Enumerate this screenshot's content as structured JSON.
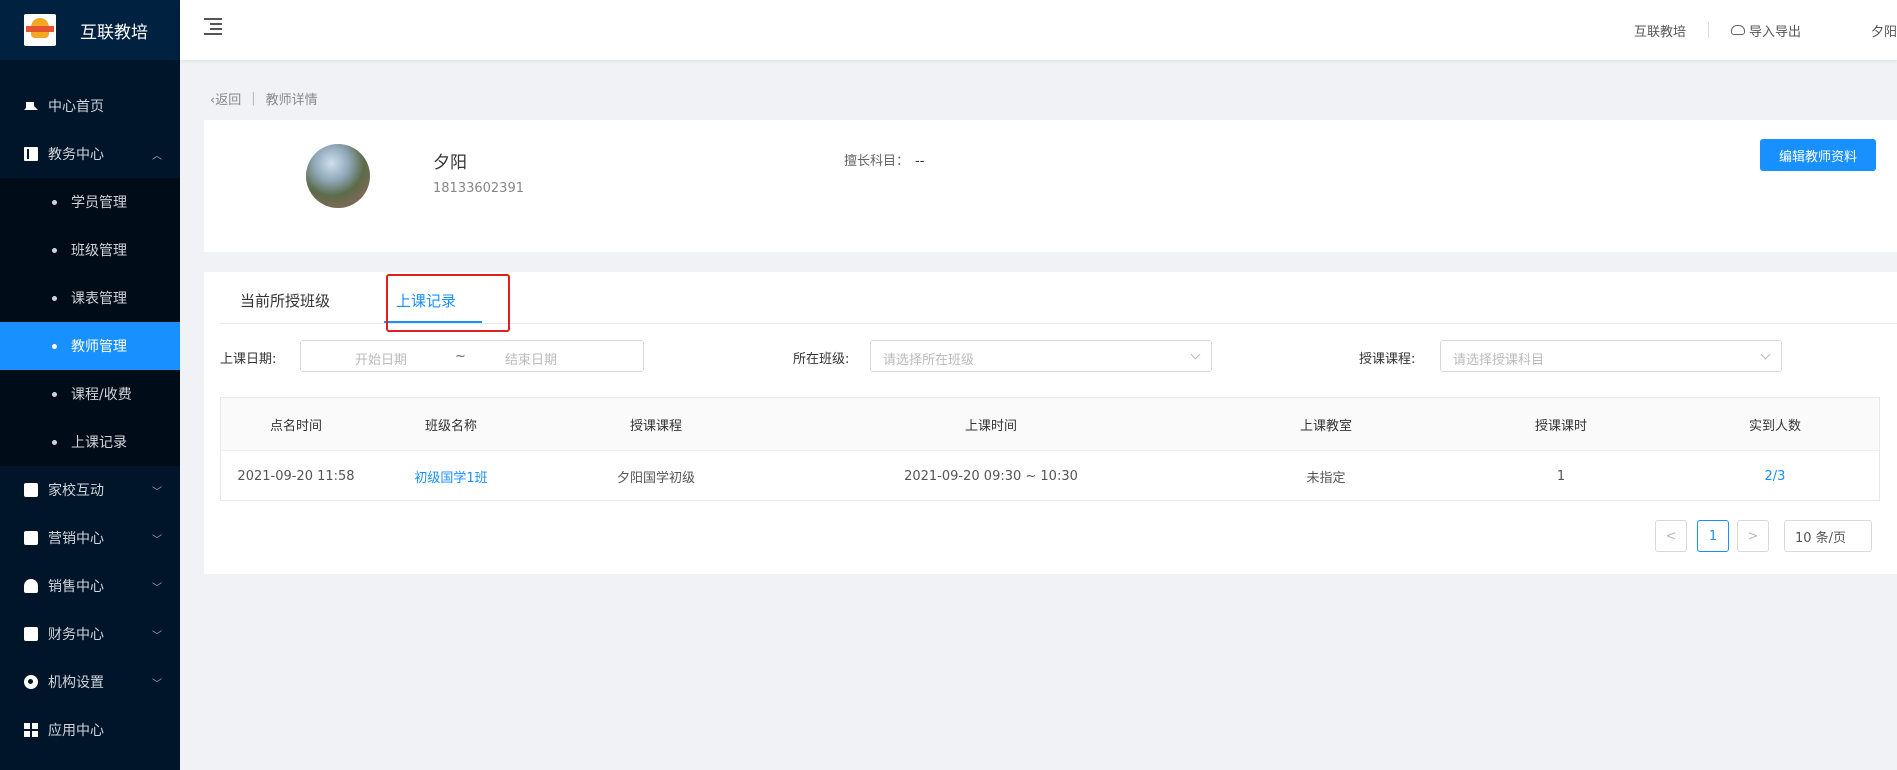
{
  "app": {
    "title": "互联教培"
  },
  "sidebar": {
    "items": [
      {
        "label": "中心首页",
        "icon": "home-icon"
      },
      {
        "label": "教务中心",
        "icon": "book-icon",
        "expanded": true
      },
      {
        "label": "家校互动",
        "icon": "chat-icon"
      },
      {
        "label": "营销中心",
        "icon": "bag-icon"
      },
      {
        "label": "销售中心",
        "icon": "user-icon"
      },
      {
        "label": "财务中心",
        "icon": "bag-icon"
      },
      {
        "label": "机构设置",
        "icon": "gear-icon"
      },
      {
        "label": "应用中心",
        "icon": "grid-icon"
      }
    ],
    "sub_items": [
      {
        "label": "学员管理"
      },
      {
        "label": "班级管理"
      },
      {
        "label": "课表管理"
      },
      {
        "label": "教师管理",
        "active": true
      },
      {
        "label": "课程/收费"
      },
      {
        "label": "上课记录"
      }
    ]
  },
  "topbar": {
    "org_name": "互联教培",
    "import_export": "导入导出",
    "user_name": "夕阳"
  },
  "breadcrumb": {
    "back": "返回",
    "separator": "|",
    "current": "教师详情"
  },
  "teacher": {
    "name": "夕阳",
    "phone": "18133602391",
    "subject_label": "擅长科目：",
    "subject_value": "--",
    "edit_button": "编辑教师资料"
  },
  "tabs": [
    {
      "label": "当前所授班级"
    },
    {
      "label": "上课记录",
      "active": true
    }
  ],
  "filters": {
    "date_label": "上课日期:",
    "start_placeholder": "开始日期",
    "range_sep": "~",
    "end_placeholder": "结束日期",
    "class_label": "所在班级:",
    "class_placeholder": "请选择所在班级",
    "course_label": "授课课程:",
    "course_placeholder": "请选择授课科目"
  },
  "table": {
    "columns": [
      "点名时间",
      "班级名称",
      "授课课程",
      "上课时间",
      "上课教室",
      "授课课时",
      "实到人数"
    ],
    "rows": [
      [
        "2021-09-20 11:58",
        "初级国学1班",
        "夕阳国学初级",
        "2021-09-20 09:30 ~ 10:30",
        "未指定",
        "1",
        "2/3"
      ]
    ]
  },
  "pagination": {
    "prev": "<",
    "current": "1",
    "next": ">",
    "page_size": "10 条/页"
  },
  "colors": {
    "accent": "#1890ff",
    "sidebar_bg": "#001529",
    "highlight": "#e02020"
  }
}
